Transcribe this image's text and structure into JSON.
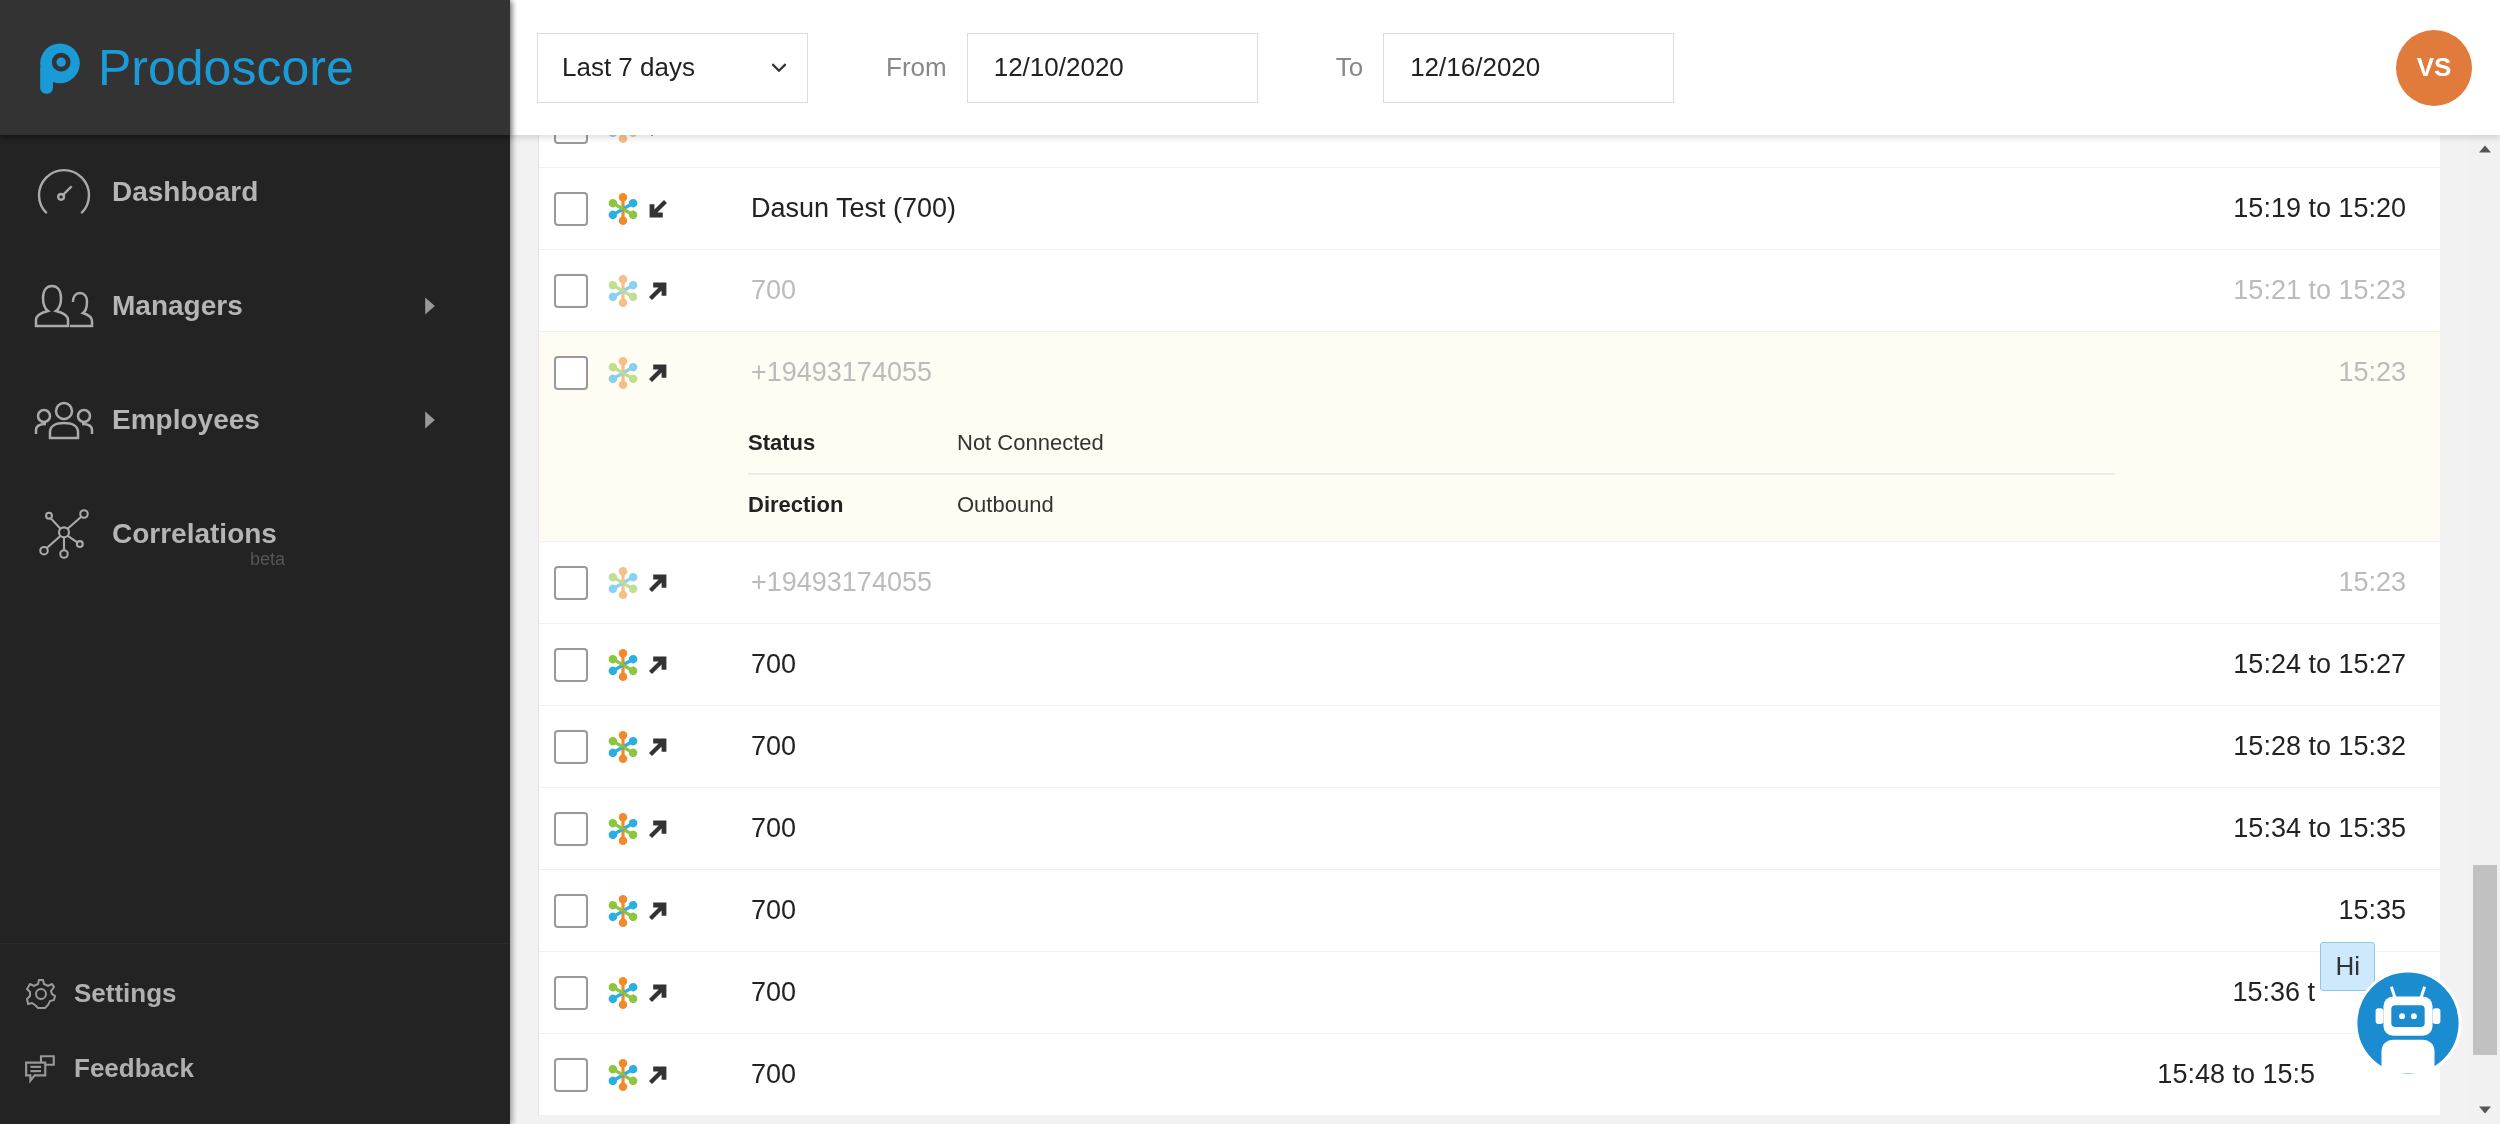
{
  "logo": {
    "text": "Prodoscore"
  },
  "nav": [
    {
      "label": "Dashboard",
      "submenu": false
    },
    {
      "label": "Managers",
      "submenu": true
    },
    {
      "label": "Employees",
      "submenu": true
    },
    {
      "label": "Correlations",
      "submenu": false,
      "badge": "beta"
    }
  ],
  "footer_nav": [
    {
      "label": "Settings"
    },
    {
      "label": "Feedback"
    }
  ],
  "filters": {
    "range": "Last 7 days",
    "from_label": "From",
    "from": "12/10/2020",
    "to_label": "To",
    "to": "12/16/2020"
  },
  "avatar": {
    "initials": "VS"
  },
  "calls": [
    {
      "incoming": false,
      "muted": true,
      "checked": false
    },
    {
      "incoming": true,
      "muted": false,
      "checked": false,
      "name": "Dasun Test (700)",
      "time": "15:19 to 15:20"
    },
    {
      "incoming": false,
      "muted": true,
      "checked": false,
      "name": "700",
      "time": "15:21 to 15:23"
    },
    {
      "incoming": false,
      "muted": true,
      "checked": false,
      "expanded": true,
      "name": "+19493174055",
      "time": "15:23",
      "details": [
        {
          "label": "Status",
          "value": "Not Connected"
        },
        {
          "label": "Direction",
          "value": "Outbound"
        }
      ]
    },
    {
      "incoming": false,
      "muted": true,
      "checked": false,
      "name": "+19493174055",
      "time": "15:23"
    },
    {
      "incoming": false,
      "muted": false,
      "checked": false,
      "name": "700",
      "time": "15:24 to 15:27"
    },
    {
      "incoming": false,
      "muted": false,
      "checked": false,
      "name": "700",
      "time": "15:28 to 15:32"
    },
    {
      "incoming": false,
      "muted": false,
      "checked": false,
      "name": "700",
      "time": "15:34 to 15:35"
    },
    {
      "incoming": false,
      "muted": false,
      "checked": false,
      "name": "700",
      "time": "15:35"
    },
    {
      "incoming": false,
      "muted": false,
      "checked": false,
      "covered": true,
      "name": "700",
      "time": "15:36 t"
    },
    {
      "incoming": false,
      "muted": false,
      "checked": false,
      "covered": true,
      "name": "700",
      "time": "15:48 to 15:5"
    }
  ],
  "chat_bubble": {
    "text": "Hi"
  }
}
